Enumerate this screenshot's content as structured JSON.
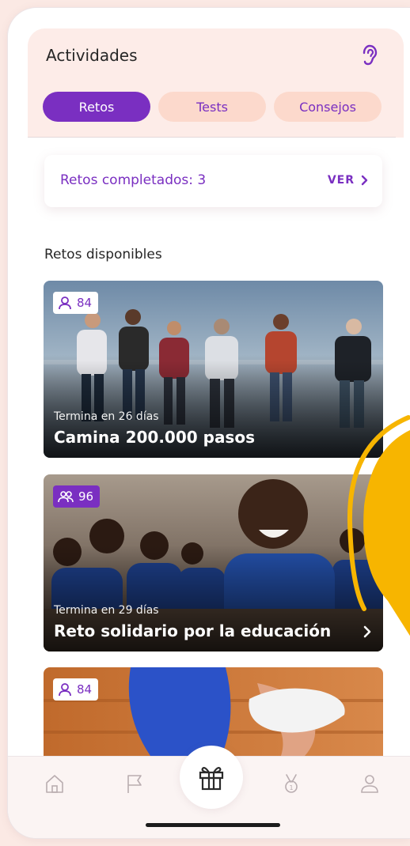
{
  "header": {
    "title": "Actividades",
    "ear_icon": "ear-icon"
  },
  "tabs": [
    {
      "label": "Retos",
      "active": true
    },
    {
      "label": "Tests",
      "active": false
    },
    {
      "label": "Consejos",
      "active": false
    }
  ],
  "completed": {
    "label": "Retos completados: 3",
    "action": "VER"
  },
  "section": {
    "title": "Retos disponibles"
  },
  "challenges": [
    {
      "participants": "84",
      "subtitle": "Termina en 26 días",
      "title": "Camina 200.000 pasos",
      "badge_icon": "person-icon"
    },
    {
      "participants": "96",
      "subtitle": "Termina en 29 días",
      "title": "Reto solidario por la educación",
      "badge_icon": "group-icon"
    },
    {
      "participants": "84",
      "subtitle": "",
      "title": "",
      "badge_icon": "person-icon"
    }
  ],
  "nav": {
    "items": [
      "home-icon",
      "flag-icon",
      "gift-icon",
      "medal-icon",
      "profile-icon"
    ]
  },
  "colors": {
    "accent": "#7a2fc1",
    "tab_inactive": "#fcd9cc",
    "header_bg": "#fdece8",
    "page_bg": "#fbe9e4",
    "blob": "#f7b500"
  }
}
